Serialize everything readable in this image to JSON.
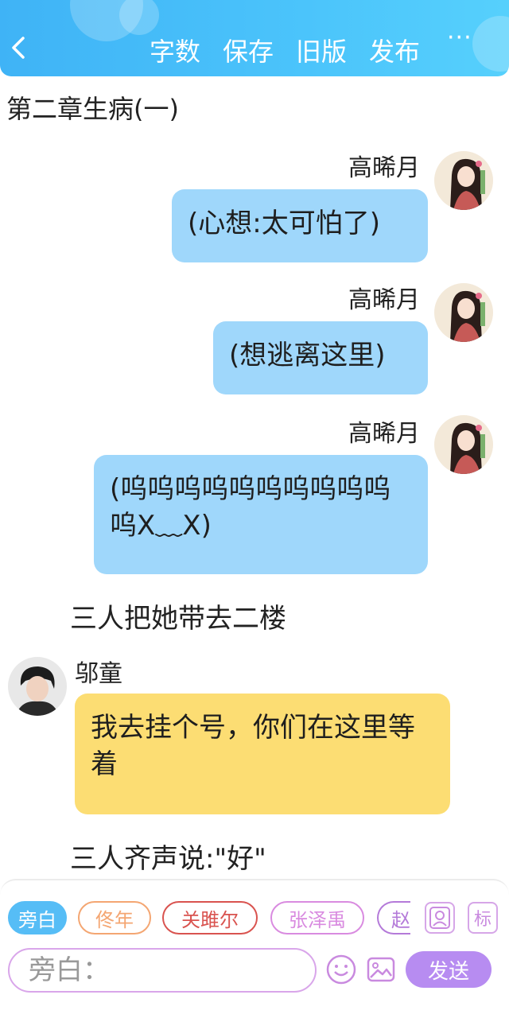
{
  "header": {
    "zishu": "字数",
    "baocun": "保存",
    "jiuban": "旧版",
    "fabu": "发布",
    "more": "···",
    "bg_color": "#45bcf8"
  },
  "chapter_title": "第二章生病(一)",
  "messages": [
    {
      "speaker": "高晞月",
      "text": "(心想:太可怕了)"
    },
    {
      "speaker": "高晞月",
      "text": "(想逃离这里)"
    },
    {
      "speaker": "高晞月",
      "text": "(呜呜呜呜呜呜呜呜呜呜呜X﹏X)"
    },
    {
      "narration": "三人把她带去二楼"
    },
    {
      "speaker": "邬童",
      "text": "我去挂个号，你们在这里等着"
    },
    {
      "narration": "三人齐声说:\"好\""
    }
  ],
  "characters": [
    {
      "label": "旁白",
      "color": "#56bdf6",
      "active": true
    },
    {
      "label": "佟年",
      "color": "#f4a672"
    },
    {
      "label": "关雎尔",
      "color": "#d9534f"
    },
    {
      "label": "张泽禹",
      "color": "#d98be0"
    },
    {
      "label": "赵",
      "color": "#b47ad9"
    }
  ],
  "input": {
    "placeholder": "旁白："
  },
  "buttons": {
    "biao": "标",
    "send": "发送"
  },
  "colors": {
    "blue_bubble": "#9fd7fb",
    "yellow_bubble": "#fcdd73",
    "send": "#b78cf1"
  }
}
